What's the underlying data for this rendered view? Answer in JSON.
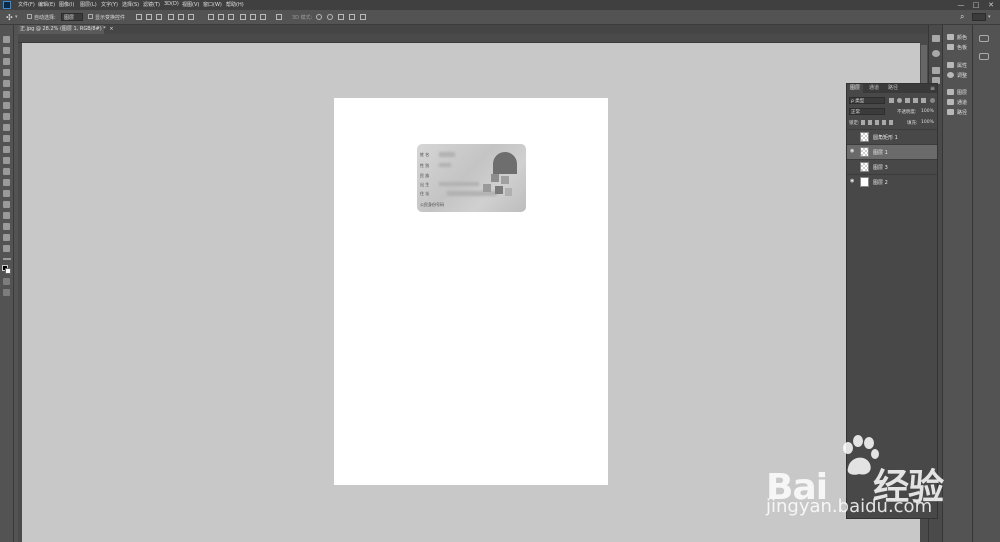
{
  "menubar": {
    "app_icon": "photoshop-logo",
    "items": [
      "文件(F)",
      "编辑(E)",
      "图像(I)",
      "图层(L)",
      "文字(Y)",
      "选择(S)",
      "滤镜(T)",
      "3D(D)",
      "视图(V)",
      "窗口(W)",
      "帮助(H)"
    ],
    "window_controls": [
      "—",
      "□",
      "✕"
    ]
  },
  "options": {
    "auto_select_label": "自动选择:",
    "auto_select_value": "图层",
    "transform_label": "显示变换控件",
    "mode_3d_label": "3D 模式:"
  },
  "document": {
    "tab_label": "正.jpg @ 28.2% (图层 1, RGB/8#) *",
    "tab_close": "×"
  },
  "layers_panel": {
    "tabs": [
      "图层",
      "通道",
      "路径"
    ],
    "active_tab": "图层",
    "filter_kind": "ρ 类型",
    "blend_mode": "正常",
    "opacity_label": "不透明度:",
    "opacity_value": "100%",
    "lock_label": "锁定:",
    "fill_label": "填充:",
    "fill_value": "100%",
    "layers": [
      {
        "name": "圆角矩形 1",
        "visible": false,
        "selected": false,
        "thumb": "checker"
      },
      {
        "name": "图层 1",
        "visible": true,
        "selected": true,
        "thumb": "checker"
      },
      {
        "name": "图层 3",
        "visible": false,
        "selected": false,
        "thumb": "checker"
      },
      {
        "name": "图层 2",
        "visible": true,
        "selected": false,
        "thumb": "white"
      }
    ]
  },
  "dock": {
    "items": [
      {
        "label": "颜色",
        "icon": "color-icon"
      },
      {
        "label": "色板",
        "icon": "swatches-icon"
      },
      {
        "label": "属性",
        "icon": "properties-icon"
      },
      {
        "label": "调整",
        "icon": "adjustments-icon"
      },
      {
        "label": "图层",
        "icon": "layers-icon"
      },
      {
        "label": "通道",
        "icon": "channels-icon"
      },
      {
        "label": "路径",
        "icon": "paths-icon"
      }
    ]
  },
  "id_card": {
    "lines": [
      "姓 名",
      "性 别",
      "民 族",
      "出 生",
      "住 址"
    ],
    "footer": "公民身份号码"
  },
  "watermark": {
    "brand": "Bai",
    "brand_tail": "经验",
    "url": "jingyan.baidu.com"
  }
}
